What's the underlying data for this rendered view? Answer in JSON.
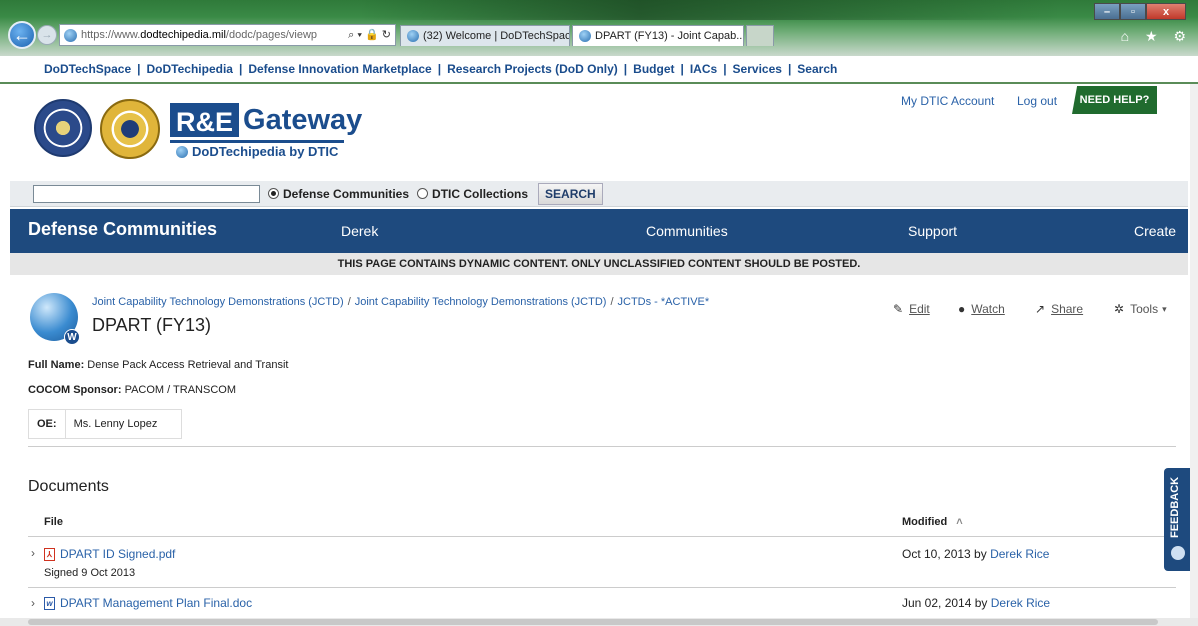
{
  "browser": {
    "url_prefix": "https://www.",
    "url_host": "dodtechipedia.mil",
    "url_path": "/dodc/pages/viewp",
    "addr_icons": "⌕ ▾ 🔒 ↻",
    "tabs": [
      {
        "label": "(32) Welcome | DoDTechSpace"
      },
      {
        "label": "DPART (FY13) - Joint Capab...",
        "close": "×"
      }
    ],
    "window_buttons": [
      "–",
      "▫",
      "x"
    ],
    "chrome_icons": "⌂ ★ ⚙"
  },
  "linkbar": {
    "links": [
      "DoDTechSpace",
      "DoDTechipedia",
      "Defense Innovation Marketplace",
      "Research Projects (DoD Only)",
      "Budget",
      "IACs",
      "Services",
      "Search"
    ],
    "separator": "|"
  },
  "header": {
    "logo_re": "R&E",
    "logo_gateway": "Gateway",
    "logo_sub": "DoDTechipedia by DTIC",
    "account_link": "My DTIC Account",
    "logout_link": "Log out",
    "help_label": "NEED HELP?"
  },
  "search": {
    "value": "",
    "radio_communities": "Defense Communities",
    "radio_collections": "DTIC Collections",
    "button_label": "SEARCH"
  },
  "nav": {
    "brand": "Defense Communities",
    "items": [
      "Derek",
      "Communities",
      "Support",
      "Create"
    ]
  },
  "notice": "THIS PAGE CONTAINS DYNAMIC CONTENT. ONLY UNCLASSIFIED CONTENT SHOULD BE POSTED.",
  "page": {
    "breadcrumbs": [
      "Joint Capability Technology Demonstrations (JCTD)",
      "Joint Capability Technology Demonstrations (JCTD)",
      "JCTDs - *ACTIVE*"
    ],
    "breadcrumb_sep": "/",
    "title": "DPART (FY13)",
    "wiki_badge": "W",
    "tools": {
      "edit": "Edit",
      "watch": "Watch",
      "share": "Share",
      "tools": "Tools"
    },
    "full_name_label": "Full Name:",
    "full_name_value": "Dense Pack Access Retrieval and Transit",
    "cocom_label": "COCOM Sponsor:",
    "cocom_value": "PACOM / TRANSCOM",
    "oe_label": "OE:",
    "oe_value": "Ms. Lenny Lopez"
  },
  "documents": {
    "heading": "Documents",
    "col_file": "File",
    "col_modified": "Modified",
    "sort_indicator": "˄",
    "rows": [
      {
        "name": "DPART ID Signed.pdf",
        "description": "Signed 9 Oct 2013",
        "modified": "Oct 10, 2013 by",
        "user": "Derek Rice",
        "type_icon": "pdf-icon"
      },
      {
        "name": "DPART Management Plan Final.doc",
        "description": "",
        "modified": "Jun 02, 2014 by",
        "user": "Derek Rice",
        "type_icon": "word-icon"
      }
    ]
  },
  "feedback_label": "FEEDBACK"
}
